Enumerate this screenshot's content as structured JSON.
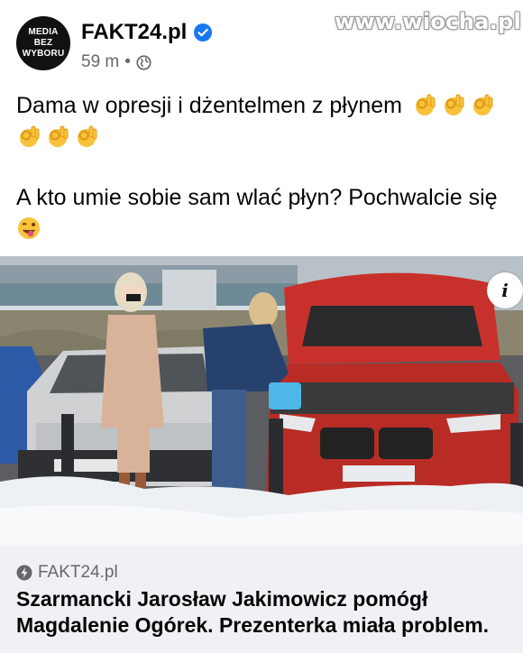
{
  "post": {
    "avatar_lines": [
      "MEDIA",
      "BEZ",
      "WYBORU"
    ],
    "page_name": "FAKT24.pl",
    "time": "59 m",
    "separator": "•",
    "watermark": "www.wiocha.pl",
    "line1": "Dama w opresji i dżentelmen z płynem",
    "line2": "A kto umie sobie sam wlać płyn? Pochwalcie się",
    "icons": {
      "verified": "verified-badge-icon",
      "audience": "globe-icon",
      "ok_hand": "ok-hand-emoji",
      "winking": "winking-tongue-emoji",
      "info": "info-icon",
      "source": "bolt-icon"
    },
    "colors": {
      "verified_blue": "#1877f2",
      "meta_gray": "#65676b",
      "link_bg": "#eff1f4",
      "car_red": "#c8312b"
    }
  },
  "media": {
    "info_label": "i"
  },
  "link": {
    "source": "FAKT24.pl",
    "headline": "Szarmancki Jarosław Jakimowicz pomógł Magdalenie Ogórek. Prezenterka miała problem."
  }
}
